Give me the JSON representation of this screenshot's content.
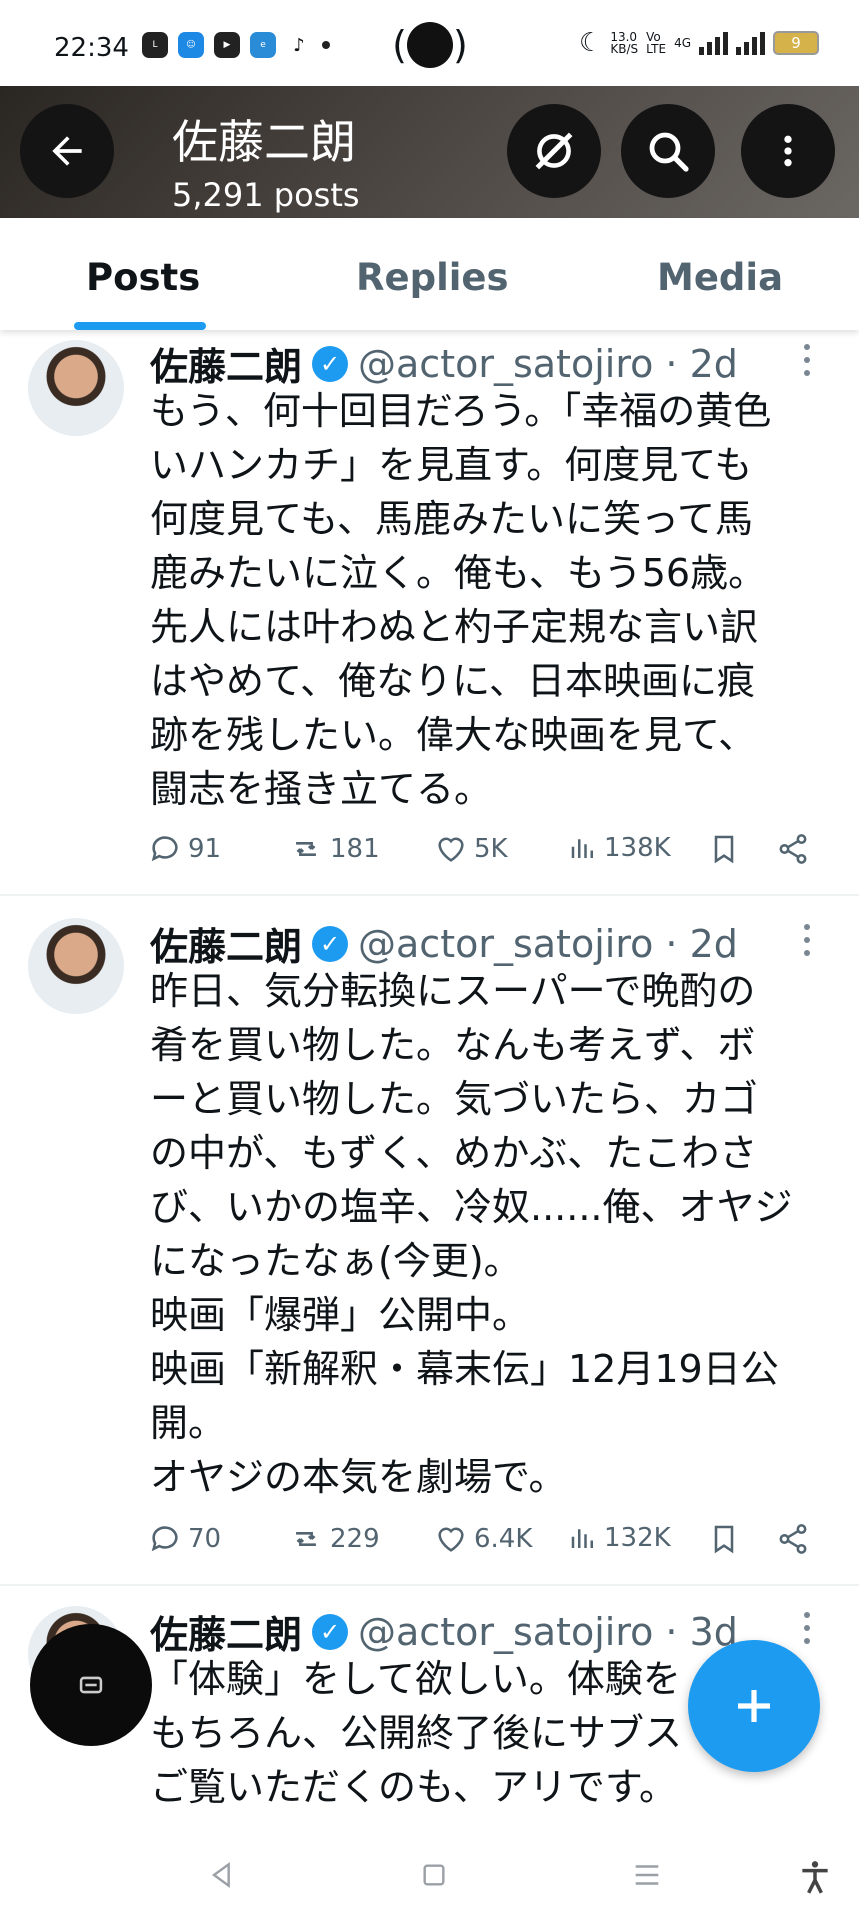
{
  "status_bar": {
    "time": "22:34",
    "net_speed": "13.0\nKB/S",
    "volte": "Vo\nLTE",
    "network": "4G",
    "battery": "9"
  },
  "header": {
    "title": "佐藤二朗",
    "subtitle": "5,291 posts"
  },
  "tabs": [
    {
      "label": "Posts",
      "active": true
    },
    {
      "label": "Replies",
      "active": false
    },
    {
      "label": "Media",
      "active": false
    }
  ],
  "posts": [
    {
      "name": "佐藤二朗",
      "handle": "@actor_satojiro · 2d",
      "text": "もう、何十回目だろう。「幸福の黄色\nいハンカチ」を見直す。何度見ても\n何度見ても、馬鹿みたいに笑って馬\n鹿みたいに泣く。俺も、もう56歳。\n先人には叶わぬと杓子定規な言い訳\nはやめて、俺なりに、日本映画に痕\n跡を残したい。偉大な映画を見て、\n闘志を掻き立てる。",
      "replies": "91",
      "reposts": "181",
      "likes": "5K",
      "views": "138K"
    },
    {
      "name": "佐藤二朗",
      "handle": "@actor_satojiro · 2d",
      "text": "昨日、気分転換にスーパーで晩酌の\n肴を買い物した。なんも考えず、ボ\nーと買い物した。気づいたら、カゴ\nの中が、もずく、めかぶ、たこわさ\nび、いかの塩辛、冷奴......俺、オヤジ\nになったなぁ(今更)。\n映画「爆弾」公開中。\n映画「新解釈・幕末伝」12月19日公\n開。\nオヤジの本気を劇場で。",
      "replies": "70",
      "reposts": "229",
      "likes": "6.4K",
      "views": "132K"
    },
    {
      "name": "佐藤二朗",
      "handle": "@actor_satojiro · 3d",
      "text": "「体験」をして欲しい。体験を\nもちろん、公開終了後にサブス\nご覧いただくのも、アリです。"
    }
  ],
  "colors": {
    "accent": "#1d9bf0",
    "text": "#0f1419",
    "muted": "#536471"
  }
}
